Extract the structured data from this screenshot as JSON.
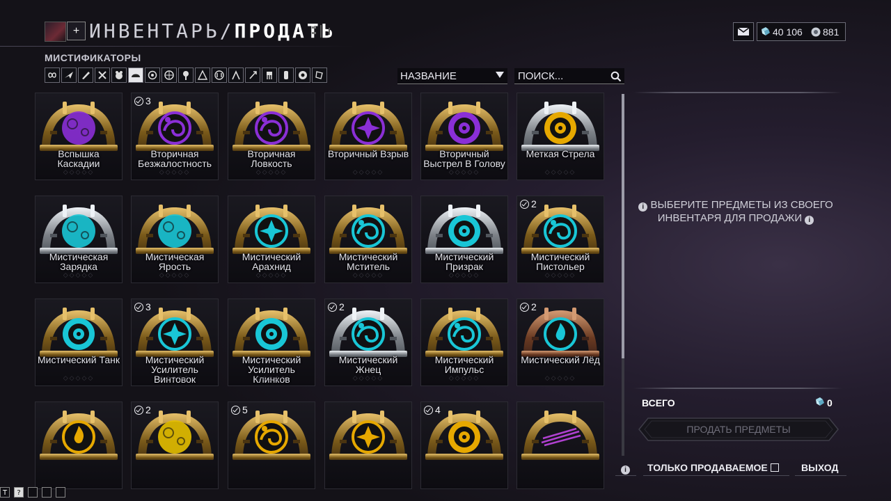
{
  "header": {
    "title_main": "ИНВЕНТАРЬ/",
    "title_sub": "ПРОДАТЬ",
    "plus_label": "+",
    "section": "МИСТИФИКАТОРЫ"
  },
  "currency": {
    "platinum": "40 106",
    "endo": "881"
  },
  "filters": [
    "infinity-icon",
    "primary-icon",
    "secondary-icon",
    "melee-icon",
    "companion-icon",
    "sentinel-icon",
    "archwing-icon",
    "robotic-icon",
    "kubrow-icon",
    "ship-icon",
    "parazon-icon",
    "necramech-icon",
    "arch-gun-icon",
    "amp-icon",
    "tome-icon",
    "riven-icon",
    "aura-icon"
  ],
  "selected_filter": 5,
  "sort": {
    "label": "НАЗВАНИЕ"
  },
  "search": {
    "placeholder": "ПОИСК..."
  },
  "items": [
    {
      "name": "Вспышка Каскадии",
      "color": "#8a2fd6",
      "frame": "gold",
      "badge": "",
      "art": "circles"
    },
    {
      "name": "Вторичная Безжалостность",
      "color": "#8a2fd6",
      "frame": "gold",
      "badge": "3",
      "art": "swirl"
    },
    {
      "name": "Вторичная Ловкость",
      "color": "#8a2fd6",
      "frame": "gold",
      "badge": "",
      "art": "swirl"
    },
    {
      "name": "Вторичный Взрыв",
      "color": "#8a2fd6",
      "frame": "gold",
      "badge": "",
      "art": "star"
    },
    {
      "name": "Вторичный Выстрел В Голову",
      "color": "#8a2fd6",
      "frame": "gold",
      "badge": "",
      "art": "target"
    },
    {
      "name": "Меткая Стрела",
      "color": "#e6a800",
      "frame": "silver",
      "badge": "",
      "art": "target"
    },
    {
      "name": "Мистическая Зарядка",
      "color": "#19c6d6",
      "frame": "silver",
      "badge": "",
      "art": "circles"
    },
    {
      "name": "Мистическая Ярость",
      "color": "#19c6d6",
      "frame": "gold",
      "badge": "",
      "art": "circles"
    },
    {
      "name": "Мистический Арахнид",
      "color": "#19c6d6",
      "frame": "gold",
      "badge": "",
      "art": "star"
    },
    {
      "name": "Мистический Мститель",
      "color": "#19c6d6",
      "frame": "gold",
      "badge": "",
      "art": "swirl"
    },
    {
      "name": "Мистический Призрак",
      "color": "#19c6d6",
      "frame": "silver",
      "badge": "",
      "art": "target"
    },
    {
      "name": "Мистический Пистольер",
      "color": "#19c6d6",
      "frame": "gold",
      "badge": "2",
      "art": "swirl"
    },
    {
      "name": "Мистический Танк",
      "color": "#19c6d6",
      "frame": "gold",
      "badge": "",
      "art": "target"
    },
    {
      "name": "Мистический Усилитель Винтовок",
      "color": "#19c6d6",
      "frame": "gold",
      "badge": "3",
      "art": "star"
    },
    {
      "name": "Мистический Усилитель Клинков",
      "color": "#19c6d6",
      "frame": "gold",
      "badge": "",
      "art": "target"
    },
    {
      "name": "Мистический Жнец",
      "color": "#19c6d6",
      "frame": "silver",
      "badge": "2",
      "art": "swirl"
    },
    {
      "name": "Мистический Импульс",
      "color": "#19c6d6",
      "frame": "gold",
      "badge": "",
      "art": "swirl"
    },
    {
      "name": "Мистический Лёд",
      "color": "#19c6d6",
      "frame": "bronze",
      "badge": "2",
      "art": "flame"
    },
    {
      "name": "",
      "color": "#e6a800",
      "frame": "gold",
      "badge": "",
      "art": "flame"
    },
    {
      "name": "",
      "color": "#e6c000",
      "frame": "gold",
      "badge": "2",
      "art": "circles"
    },
    {
      "name": "",
      "color": "#e6a800",
      "frame": "gold",
      "badge": "5",
      "art": "swirl"
    },
    {
      "name": "",
      "color": "#e6a800",
      "frame": "gold",
      "badge": "",
      "art": "star"
    },
    {
      "name": "",
      "color": "#e6a800",
      "frame": "gold",
      "badge": "4",
      "art": "target"
    },
    {
      "name": "",
      "color": "#b040d0",
      "frame": "gold",
      "badge": "",
      "art": "slash"
    }
  ],
  "right_panel": {
    "hint": "ВЫБЕРИТЕ ПРЕДМЕТЫ ИЗ СВОЕГО ИНВЕНТАРЯ ДЛЯ ПРОДАЖИ",
    "total_label": "ВСЕГО",
    "total_value": "0",
    "sell_button": "ПРОДАТЬ ПРЕДМЕТЫ"
  },
  "bottom_bar": {
    "only_sellable": "ТОЛЬКО ПРОДАВАЕМОЕ",
    "exit": "ВЫХОД"
  },
  "debug_keys": [
    "T",
    "?",
    "",
    "",
    ""
  ]
}
